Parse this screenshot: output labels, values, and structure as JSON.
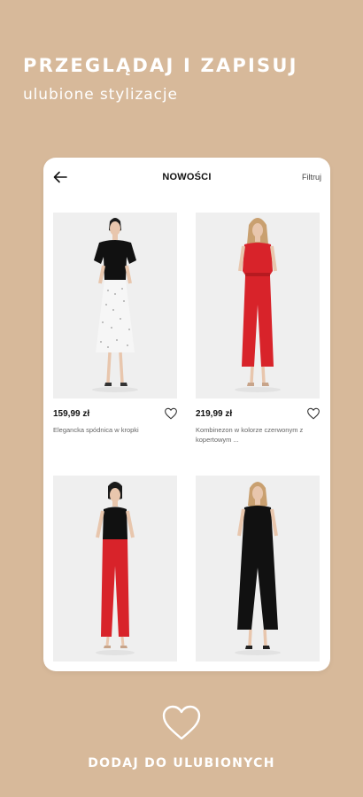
{
  "promo": {
    "title": "PRZEGLĄDAJ I ZAPISUJ",
    "subtitle": "ulubione stylizacje",
    "cta": "DODAJ DO ULUBIONYCH"
  },
  "colors": {
    "background": "#d7b99a",
    "card": "#ffffff",
    "photo_bg": "#efefef",
    "accent_red": "#d8232a"
  },
  "app": {
    "header": {
      "title": "NOWOŚCI",
      "filter_label": "Filtruj",
      "back_icon": "arrow-left-icon"
    },
    "products": [
      {
        "price": "159,99 zł",
        "name": "Elegancka spódnica w kropki",
        "favorite": false,
        "icon": "heart-outline-icon"
      },
      {
        "price": "219,99 zł",
        "name": "Kombinezon w kolorze czerwonym z kopertowym ...",
        "favorite": false,
        "icon": "heart-outline-icon"
      },
      {
        "price": "",
        "name": "",
        "favorite": false
      },
      {
        "price": "",
        "name": "",
        "favorite": false
      }
    ]
  }
}
